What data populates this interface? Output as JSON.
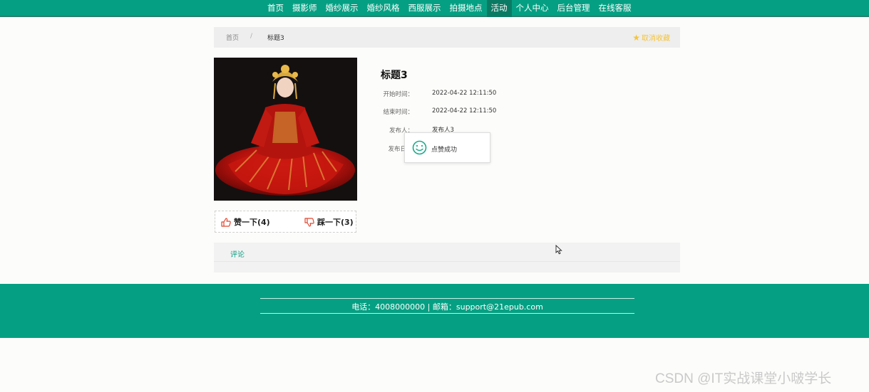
{
  "nav": {
    "items": [
      {
        "label": "首页",
        "active": false
      },
      {
        "label": "摄影师",
        "active": false
      },
      {
        "label": "婚纱展示",
        "active": false
      },
      {
        "label": "婚纱风格",
        "active": false
      },
      {
        "label": "西服展示",
        "active": false
      },
      {
        "label": "拍摄地点",
        "active": false
      },
      {
        "label": "活动",
        "active": true
      },
      {
        "label": "个人中心",
        "active": false
      },
      {
        "label": "后台管理",
        "active": false
      },
      {
        "label": "在线客服",
        "active": false
      }
    ]
  },
  "breadcrumb": {
    "home": "首页",
    "separator": "/",
    "current": "标题3",
    "favorite_label": "取消收藏"
  },
  "detail": {
    "title": "标题3",
    "fields": [
      {
        "label": "开始时间：",
        "value": "2022-04-22 12:11:50"
      },
      {
        "label": "结束时间：",
        "value": "2022-04-22 12:11:50"
      },
      {
        "label": "发布人：",
        "value": "发布人3"
      },
      {
        "label": "发布日",
        "value": ""
      }
    ]
  },
  "votes": {
    "like_label": "赞一下(4)",
    "dislike_label": "踩一下(3)"
  },
  "toast": {
    "message": "点赞成功"
  },
  "comments": {
    "tab_label": "评论"
  },
  "footer": {
    "contact": "电话：4008000000 | 邮箱：support@21epub.com"
  },
  "watermark": "CSDN @IT实战课堂小啵学长",
  "colors": {
    "brand": "#05a083",
    "favorite": "#f4c43c",
    "vote_icon": "#e0452f"
  }
}
